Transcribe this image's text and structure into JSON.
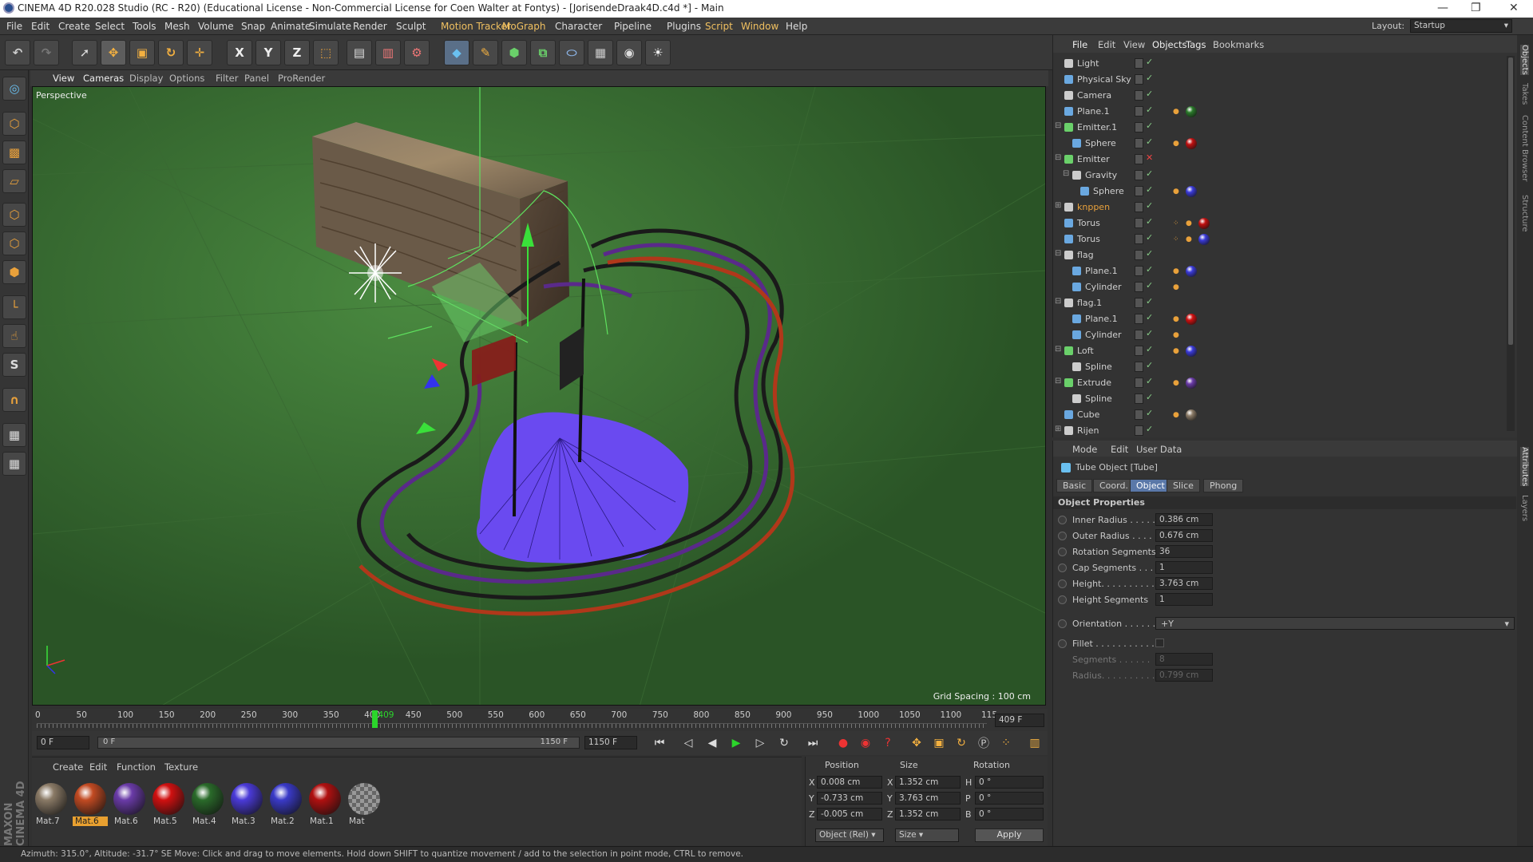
{
  "window": {
    "title": "CINEMA 4D R20.028 Studio (RC - R20) (Educational License - Non-Commercial License for Coen  Walter at Fontys) - [JorisendeDraak4D.c4d *] - Main"
  },
  "menubar": {
    "items": [
      "File",
      "Edit",
      "Create",
      "Select",
      "Tools",
      "Mesh",
      "Volume",
      "Snap",
      "Animate",
      "Simulate",
      "Render",
      "Sculpt",
      "Motion Tracker",
      "MoGraph",
      "Character",
      "Pipeline",
      "Plugins",
      "Script",
      "Window",
      "Help"
    ],
    "layout_label": "Layout:",
    "layout_value": "Startup"
  },
  "toolbar": {
    "axis_x": "X",
    "axis_y": "Y",
    "axis_z": "Z"
  },
  "viewport": {
    "menu": [
      "View",
      "Cameras",
      "Display",
      "Options",
      "Filter",
      "Panel",
      "ProRender"
    ],
    "label": "Perspective",
    "grid_spacing": "Grid Spacing : 100 cm"
  },
  "timeline": {
    "ticks": [
      "0",
      "50",
      "100",
      "150",
      "200",
      "250",
      "300",
      "350",
      "400",
      "409",
      "450",
      "500",
      "550",
      "600",
      "650",
      "700",
      "750",
      "800",
      "850",
      "900",
      "950",
      "1000",
      "1050",
      "1100",
      "115"
    ],
    "current_frame_display": "409 F",
    "start": "0 F",
    "range_start": "0 F",
    "range_end": "1150 F",
    "end": "1150 F",
    "current_frame": 409,
    "max_frame": 1150
  },
  "materials": {
    "menu": [
      "Create",
      "Edit",
      "Function",
      "Texture"
    ],
    "items": [
      {
        "label": "Mat.7",
        "color": "#8a7a66"
      },
      {
        "label": "Mat.6",
        "color": "#c24a22",
        "selected": true
      },
      {
        "label": "Mat.6",
        "color": "#6a3ba8"
      },
      {
        "label": "Mat.5",
        "color": "#d01010"
      },
      {
        "label": "Mat.4",
        "color": "#2a6a2a"
      },
      {
        "label": "Mat.3",
        "color": "#4a3ad8"
      },
      {
        "label": "Mat.2",
        "color": "#3a3ac8"
      },
      {
        "label": "Mat.1",
        "color": "#b01010"
      },
      {
        "label": "Mat",
        "color": "#888888"
      }
    ]
  },
  "coords": {
    "headers": [
      "Position",
      "Size",
      "Rotation"
    ],
    "rows": [
      {
        "axis": "X",
        "pos": "0.008 cm",
        "size_axis": "X",
        "size": "1.352 cm",
        "rot_axis": "H",
        "rot": "0 °"
      },
      {
        "axis": "Y",
        "pos": "-0.733 cm",
        "size_axis": "Y",
        "size": "3.763 cm",
        "rot_axis": "P",
        "rot": "0 °"
      },
      {
        "axis": "Z",
        "pos": "-0.005 cm",
        "size_axis": "Z",
        "size": "1.352 cm",
        "rot_axis": "B",
        "rot": "0 °"
      }
    ],
    "mode": "Object (Rel)",
    "size_mode": "Size",
    "apply": "Apply"
  },
  "status": {
    "text": "Azimuth: 315.0°, Altitude: -31.7°  SE     Move: Click and drag to move elements. Hold down SHIFT to quantize movement / add to the selection in point mode, CTRL to remove."
  },
  "object_manager": {
    "menu": [
      "File",
      "Edit",
      "View",
      "Objects",
      "Tags",
      "Bookmarks"
    ],
    "objects": [
      {
        "name": "Light",
        "indent": 0,
        "icon": "#cccccc"
      },
      {
        "name": "Physical Sky",
        "indent": 0,
        "icon": "#6aa8e0"
      },
      {
        "name": "Camera",
        "indent": 0,
        "icon": "#cccccc"
      },
      {
        "name": "Plane.1",
        "indent": 0,
        "icon": "#6aa8e0",
        "tag": "#2a7a2a"
      },
      {
        "name": "Emitter.1",
        "indent": 0,
        "icon": "#6ad06a",
        "expand": "-"
      },
      {
        "name": "Sphere",
        "indent": 1,
        "icon": "#6aa8e0",
        "tag": "#c01010"
      },
      {
        "name": "Emitter",
        "indent": 0,
        "icon": "#6ad06a",
        "expand": "-",
        "xmark": true
      },
      {
        "name": "Gravity",
        "indent": 1,
        "icon": "#cccccc",
        "expand": "-"
      },
      {
        "name": "Sphere",
        "indent": 2,
        "icon": "#6aa8e0",
        "tag": "#3a3ad8"
      },
      {
        "name": "knppen",
        "indent": 0,
        "icon": "#cccccc",
        "expand": "+",
        "orange": true
      },
      {
        "name": "Torus",
        "indent": 0,
        "icon": "#6aa8e0",
        "tag": "#c01010",
        "dots": true
      },
      {
        "name": "Torus",
        "indent": 0,
        "icon": "#6aa8e0",
        "tag": "#3a3ad8",
        "dots": true
      },
      {
        "name": "flag",
        "indent": 0,
        "icon": "#cccccc",
        "expand": "-"
      },
      {
        "name": "Plane.1",
        "indent": 1,
        "icon": "#6aa8e0",
        "tag": "#3a3ad8"
      },
      {
        "name": "Cylinder",
        "indent": 1,
        "icon": "#6aa8e0"
      },
      {
        "name": "flag.1",
        "indent": 0,
        "icon": "#cccccc",
        "expand": "-"
      },
      {
        "name": "Plane.1",
        "indent": 1,
        "icon": "#6aa8e0",
        "tag": "#d01010"
      },
      {
        "name": "Cylinder",
        "indent": 1,
        "icon": "#6aa8e0"
      },
      {
        "name": "Loft",
        "indent": 0,
        "icon": "#6ad06a",
        "expand": "-",
        "tag": "#3a3ad8"
      },
      {
        "name": "Spline",
        "indent": 1,
        "icon": "#cccccc"
      },
      {
        "name": "Extrude",
        "indent": 0,
        "icon": "#6ad06a",
        "expand": "-",
        "tag": "#6a3ba8"
      },
      {
        "name": "Spline",
        "indent": 1,
        "icon": "#cccccc"
      },
      {
        "name": "Cube",
        "indent": 0,
        "icon": "#6aa8e0",
        "tag": "#8a7a66"
      },
      {
        "name": "Rijen",
        "indent": 0,
        "icon": "#cccccc",
        "expand": "+"
      }
    ]
  },
  "attributes": {
    "menu": [
      "Mode",
      "Edit",
      "User Data"
    ],
    "title": "Tube Object [Tube]",
    "tabs": [
      "Basic",
      "Coord.",
      "Object",
      "Slice",
      "Phong"
    ],
    "active_tab": "Object",
    "section": "Object Properties",
    "props": [
      {
        "label": "Inner Radius . . . . .",
        "value": "0.386 cm"
      },
      {
        "label": "Outer Radius . . . .",
        "value": "0.676 cm"
      },
      {
        "label": "Rotation Segments",
        "value": "36"
      },
      {
        "label": "Cap Segments . . . .",
        "value": "1"
      },
      {
        "label": "Height. . . . . . . . . .",
        "value": "3.763 cm"
      },
      {
        "label": "Height Segments",
        "value": "1"
      }
    ],
    "orientation_label": "Orientation . . . . . .",
    "orientation_value": "+Y",
    "fillet_label": "Fillet . . . . . . . . . . .",
    "segments_label": "Segments . . . . . .",
    "segments_value": "8",
    "radius_label": "Radius. . . . . . . . . .",
    "radius_value": "0.799 cm"
  },
  "right_strip": [
    "Objects",
    "Takes",
    "Content Browser",
    "Structure",
    "Attributes",
    "Layers"
  ]
}
